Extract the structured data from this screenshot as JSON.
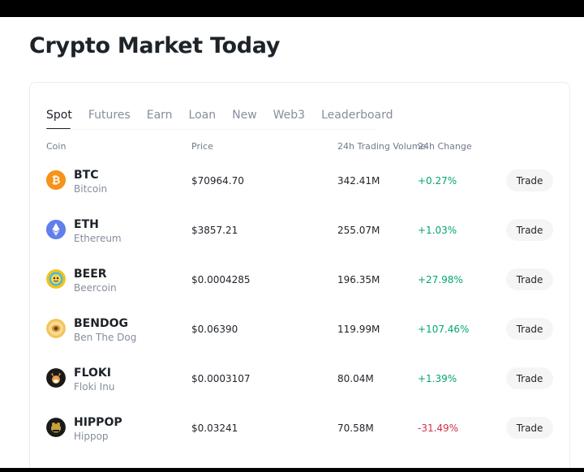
{
  "page": {
    "title": "Crypto Market Today"
  },
  "tabs": [
    {
      "label": "Spot",
      "active": true
    },
    {
      "label": "Futures",
      "active": false
    },
    {
      "label": "Earn",
      "active": false
    },
    {
      "label": "Loan",
      "active": false
    },
    {
      "label": "New",
      "active": false
    },
    {
      "label": "Web3",
      "active": false
    },
    {
      "label": "Leaderboard",
      "active": false
    }
  ],
  "columns": {
    "coin": "Coin",
    "price": "Price",
    "volume": "24h Trading Volume",
    "change": "24h Change"
  },
  "rows": [
    {
      "symbol": "BTC",
      "name": "Bitcoin",
      "price": "$70964.70",
      "volume": "342.41M",
      "change": "+0.27%",
      "direction": "up",
      "icon": "bitcoin-icon",
      "icon_color": "#f7931a",
      "trade": "Trade"
    },
    {
      "symbol": "ETH",
      "name": "Ethereum",
      "price": "$3857.21",
      "volume": "255.07M",
      "change": "+1.03%",
      "direction": "up",
      "icon": "ethereum-icon",
      "icon_color": "#627eea",
      "trade": "Trade"
    },
    {
      "symbol": "BEER",
      "name": "Beercoin",
      "price": "$0.0004285",
      "volume": "196.35M",
      "change": "+27.98%",
      "direction": "up",
      "icon": "beercoin-icon",
      "icon_color": "#f0c419",
      "trade": "Trade"
    },
    {
      "symbol": "BENDOG",
      "name": "Ben The Dog",
      "price": "$0.06390",
      "volume": "119.99M",
      "change": "+107.46%",
      "direction": "up",
      "icon": "bendog-icon",
      "icon_color": "#f3c35a",
      "trade": "Trade"
    },
    {
      "symbol": "FLOKI",
      "name": "Floki Inu",
      "price": "$0.0003107",
      "volume": "80.04M",
      "change": "+1.39%",
      "direction": "up",
      "icon": "floki-icon",
      "icon_color": "#1a1a1a",
      "trade": "Trade"
    },
    {
      "symbol": "HIPPOP",
      "name": "Hippop",
      "price": "$0.03241",
      "volume": "70.58M",
      "change": "-31.49%",
      "direction": "down",
      "icon": "hippop-icon",
      "icon_color": "#1a1a1a",
      "trade": "Trade"
    }
  ],
  "colors": {
    "up": "#03a66d",
    "down": "#cf304a",
    "text": "#1e2329",
    "muted": "#848e9c"
  }
}
